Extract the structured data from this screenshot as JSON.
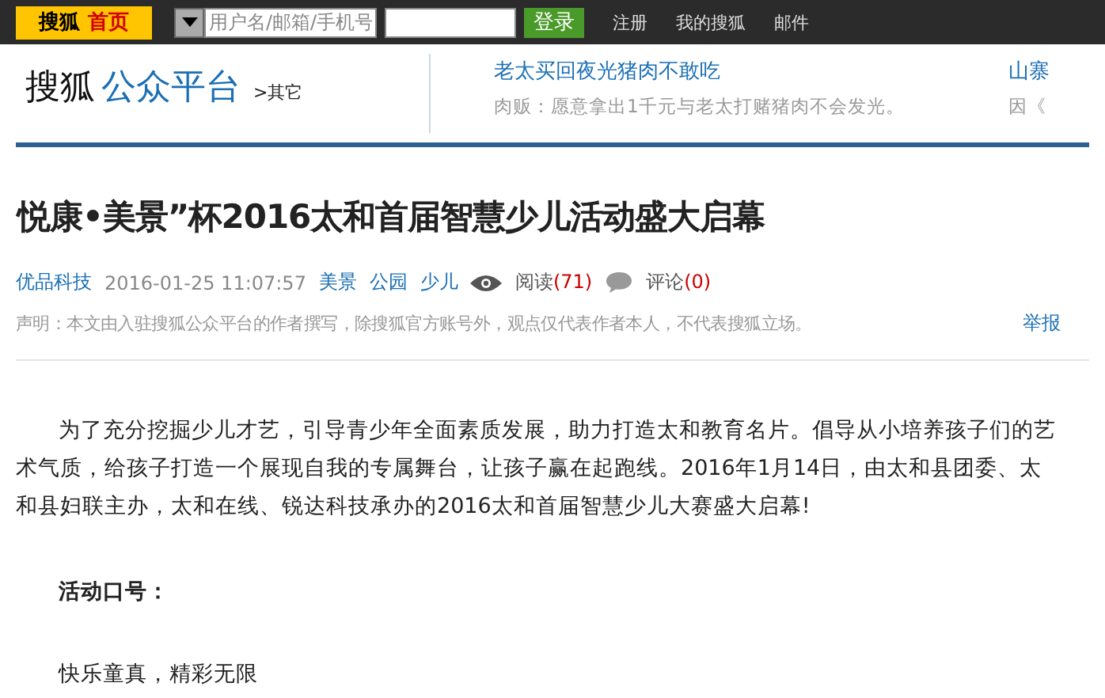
{
  "top_bar": {
    "logo": "搜狐",
    "home": "首页",
    "username": {
      "placeholder": "用户名/邮箱/手机号"
    },
    "login": "登录",
    "links": [
      "注册",
      "我的搜狐",
      "邮件"
    ]
  },
  "header": {
    "brand": "搜狐",
    "platform": "公众平台",
    "other": ">其它",
    "news": [
      {
        "title": "老太买回夜光猪肉不敢吃",
        "summary": "肉贩：愿意拿出1千元与老太打赌猪肉不会发光。"
      },
      {
        "title": "山寨",
        "summary": "因《"
      }
    ]
  },
  "article": {
    "title": "悦康•美景”杯2016太和首届智慧少儿活动盛大启幕",
    "source": "优品科技",
    "time": "2016-01-25 11:07:57",
    "tags": [
      "美景",
      "公园",
      "少儿"
    ],
    "reads_label": "阅读",
    "reads": "(71)",
    "comments_label": "评论",
    "comments": "(0)",
    "disclaimer": "声明：本文由入驻搜狐公众平台的作者撰写，除搜狐官方账号外，观点仅代表作者本人，不代表搜狐立场。",
    "report": "举报",
    "paragraphs": [
      {
        "kind": "text",
        "text": "为了充分挖掘少儿才艺，引导青少年全面素质发展，助力打造太和教育名片。倡导从小培养孩子们的艺术气质，给孩子打造一个展现自我的专属舞台，让孩子赢在起跑线。2016年1月14日，由太和县团委、太和县妇联主办，太和在线、锐达科技承办的2016太和首届智慧少儿大赛盛大启幕!"
      },
      {
        "kind": "heading",
        "text": "活动口号："
      },
      {
        "kind": "text",
        "text": "快乐童真，精彩无限"
      }
    ]
  }
}
